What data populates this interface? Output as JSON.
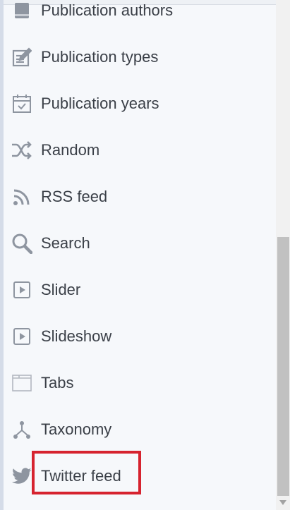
{
  "menu": {
    "items": [
      {
        "label": "Publication authors",
        "icon": "publication-authors-icon"
      },
      {
        "label": "Publication types",
        "icon": "publication-types-icon"
      },
      {
        "label": "Publication years",
        "icon": "calendar-icon"
      },
      {
        "label": "Random",
        "icon": "shuffle-icon"
      },
      {
        "label": "RSS feed",
        "icon": "rss-icon"
      },
      {
        "label": "Search",
        "icon": "search-icon"
      },
      {
        "label": "Slider",
        "icon": "slider-icon"
      },
      {
        "label": "Slideshow",
        "icon": "slideshow-icon"
      },
      {
        "label": "Tabs",
        "icon": "tabs-icon"
      },
      {
        "label": "Taxonomy",
        "icon": "taxonomy-icon"
      },
      {
        "label": "Twitter feed",
        "icon": "twitter-icon"
      }
    ],
    "highlighted_item": "Twitter feed"
  },
  "colors": {
    "panel_background": "#f6f8fb",
    "text": "#3a3f47",
    "icon": "#8e95a0",
    "highlight_border": "#d6232f",
    "scrollbar_thumb": "#c1c1c1"
  }
}
